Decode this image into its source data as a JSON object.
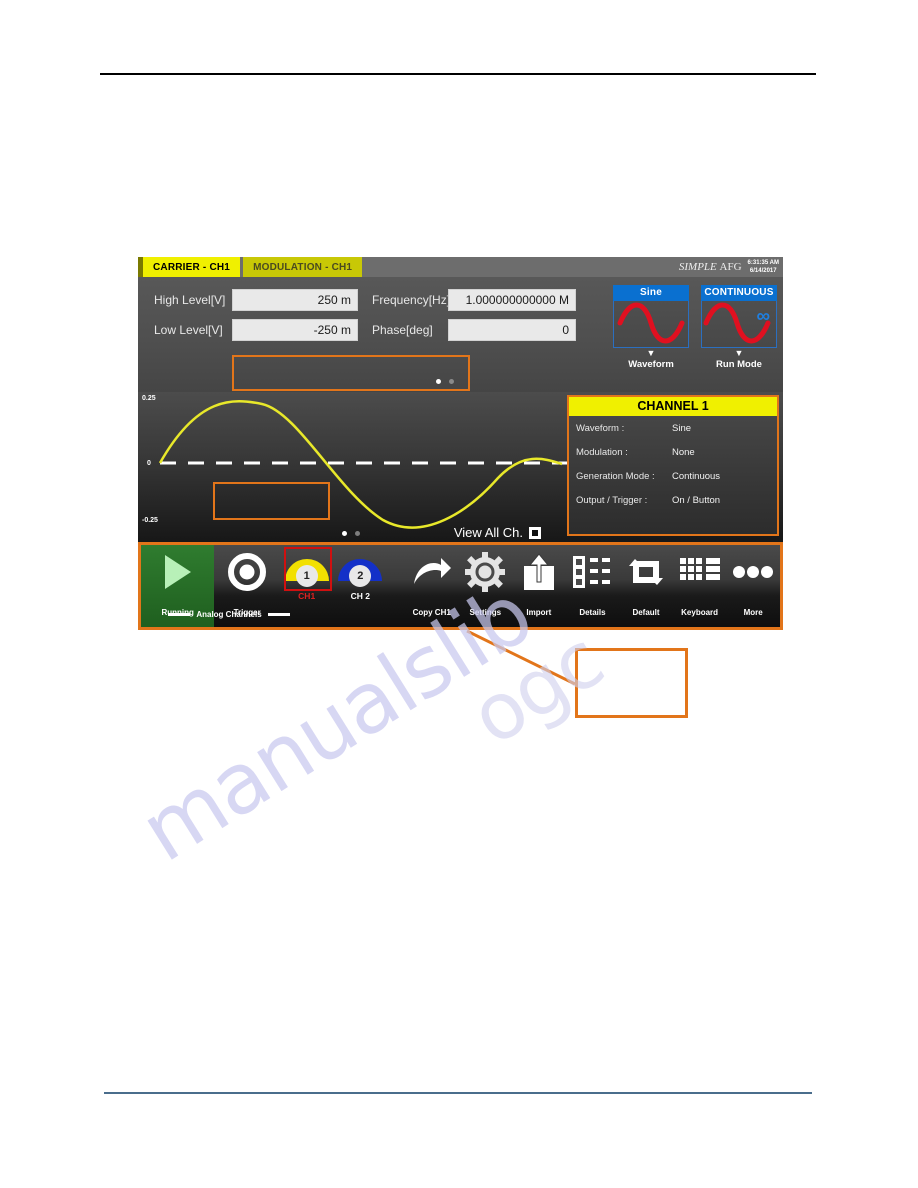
{
  "document": {
    "watermark_line1": "manualslib",
    "watermark_line2": "ogc"
  },
  "device": {
    "tabs": [
      {
        "label": "CARRIER - CH1",
        "active": true
      },
      {
        "label": "MODULATION - CH1",
        "active": false
      }
    ],
    "brand": {
      "name_italic": "SIMPLE",
      "name_plain": "AFG",
      "time": "6:31:35 AM",
      "date": "6/14/2017"
    },
    "parameters": {
      "high_level": {
        "label": "High Level[V]",
        "value": "250 m"
      },
      "low_level": {
        "label": "Low Level[V]",
        "value": "-250 m"
      },
      "frequency": {
        "label": "Frequency[Hz]",
        "value": "1.000000000000 M"
      },
      "phase": {
        "label": "Phase[deg]",
        "value": "0"
      }
    },
    "mode_buttons": [
      {
        "caption": "Sine",
        "label": "Waveform",
        "icon": "sine-wave-icon"
      },
      {
        "caption": "CONTINUOUS",
        "label": "Run Mode",
        "icon": "infinity-icon"
      }
    ],
    "plot": {
      "y_top": "0.25",
      "y_mid": "0",
      "y_bottom": "-0.25",
      "view_all_label": "View All Ch.",
      "view_all_checked": false,
      "trace_color": "#e8e82a",
      "zero_line_color": "#ffffff"
    },
    "channel_panel": {
      "title": "CHANNEL 1",
      "rows": [
        {
          "key": "Waveform :",
          "value": "Sine"
        },
        {
          "key": "Modulation :",
          "value": "None"
        },
        {
          "key": "Generation Mode :",
          "value": "Continuous"
        },
        {
          "key": "Output / Trigger :",
          "value": "On / Button"
        }
      ]
    },
    "toolbar": {
      "run": {
        "label": "Running",
        "icon": "play-icon"
      },
      "trigger": {
        "label": "Trigger",
        "icon": "target-icon"
      },
      "channels": {
        "group_label": "Analog Channels",
        "ch1": {
          "label": "CH1",
          "number": "1",
          "selected": true,
          "color": "#f2e000"
        },
        "ch2": {
          "label": "CH 2",
          "number": "2",
          "selected": false,
          "color": "#1330c8"
        }
      },
      "items": [
        {
          "label": "Copy CH1",
          "icon": "curved-arrow-icon"
        },
        {
          "label": "Settings",
          "icon": "gear-icon"
        },
        {
          "label": "Import",
          "icon": "upload-icon"
        },
        {
          "label": "Details",
          "icon": "list-detail-icon"
        },
        {
          "label": "Default",
          "icon": "refresh-arrows-icon"
        },
        {
          "label": "Keyboard",
          "icon": "keyboard-grid-icon"
        },
        {
          "label": "More",
          "icon": "ellipsis-icon"
        }
      ]
    }
  },
  "callout": {
    "text": "",
    "border_color": "#e2751a"
  },
  "colors": {
    "accent_orange": "#e2751a",
    "tab_yellow": "#f0f000",
    "blue": "#0a70d0",
    "green": "#2f7c2f",
    "red_select": "#d01010"
  }
}
